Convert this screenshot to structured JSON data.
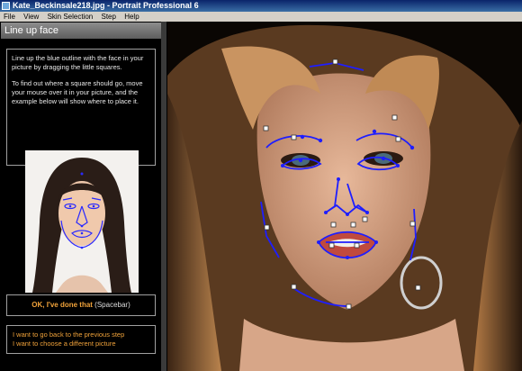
{
  "window": {
    "title": "Kate_Beckinsale218.jpg - Portrait Professional 6"
  },
  "menu": [
    "File",
    "View",
    "Skin Selection",
    "Step",
    "Help"
  ],
  "panel": {
    "header": "Line up face",
    "paragraph1": "Line up the blue outline with the face in your picture by dragging the little squares.",
    "paragraph2": "To find out where a square should go, move your mouse over it in your picture, and the example below will show where to place it.",
    "ok_label": "OK, I've done that",
    "ok_shortcut": "(Spacebar)",
    "link_previous": "I want to go back to the previous step",
    "link_different": "I want to choose a different picture"
  },
  "colors": {
    "outline": "#2a2aff",
    "accent": "#f0a23a",
    "panel_bg": "#000000"
  }
}
